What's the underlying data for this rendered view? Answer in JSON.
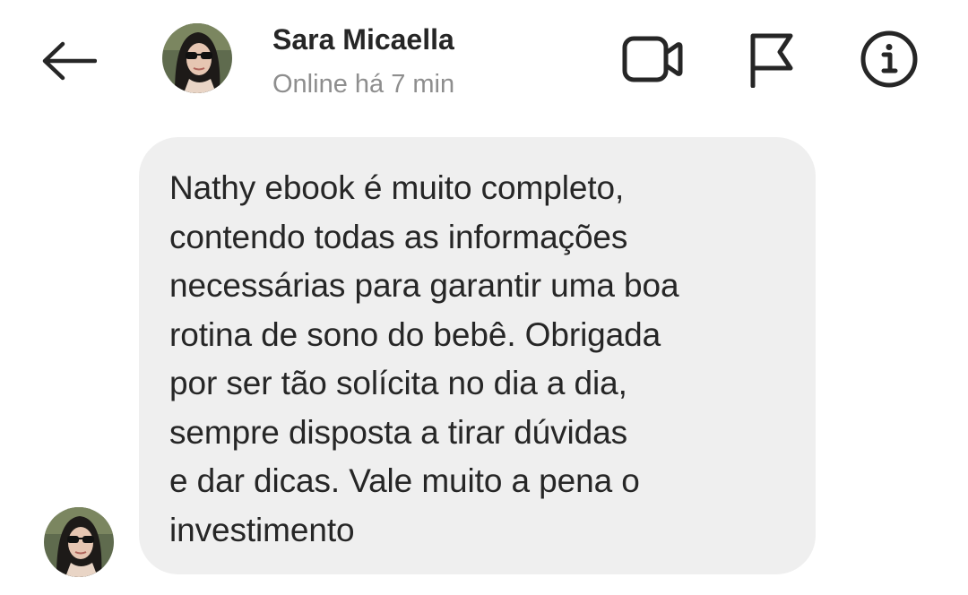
{
  "header": {
    "contact_name": "Sara Micaella",
    "status": "Online há 7 min",
    "icons": {
      "back": "back-arrow-icon",
      "video": "video-camera-icon",
      "flag": "flag-icon",
      "info": "info-icon"
    }
  },
  "message": {
    "lines": [
      "Nathy ebook é muito completo,",
      "contendo todas as informações",
      "necessárias para garantir uma boa",
      "rotina de sono do bebê. Obrigada",
      "por ser tão solícita no dia a dia,",
      "sempre disposta a tirar dúvidas",
      "e dar dicas. Vale muito a pena o",
      "investimento"
    ]
  },
  "colors": {
    "bubble": "#efefef",
    "text": "#262626",
    "status": "#8e8e8e"
  }
}
